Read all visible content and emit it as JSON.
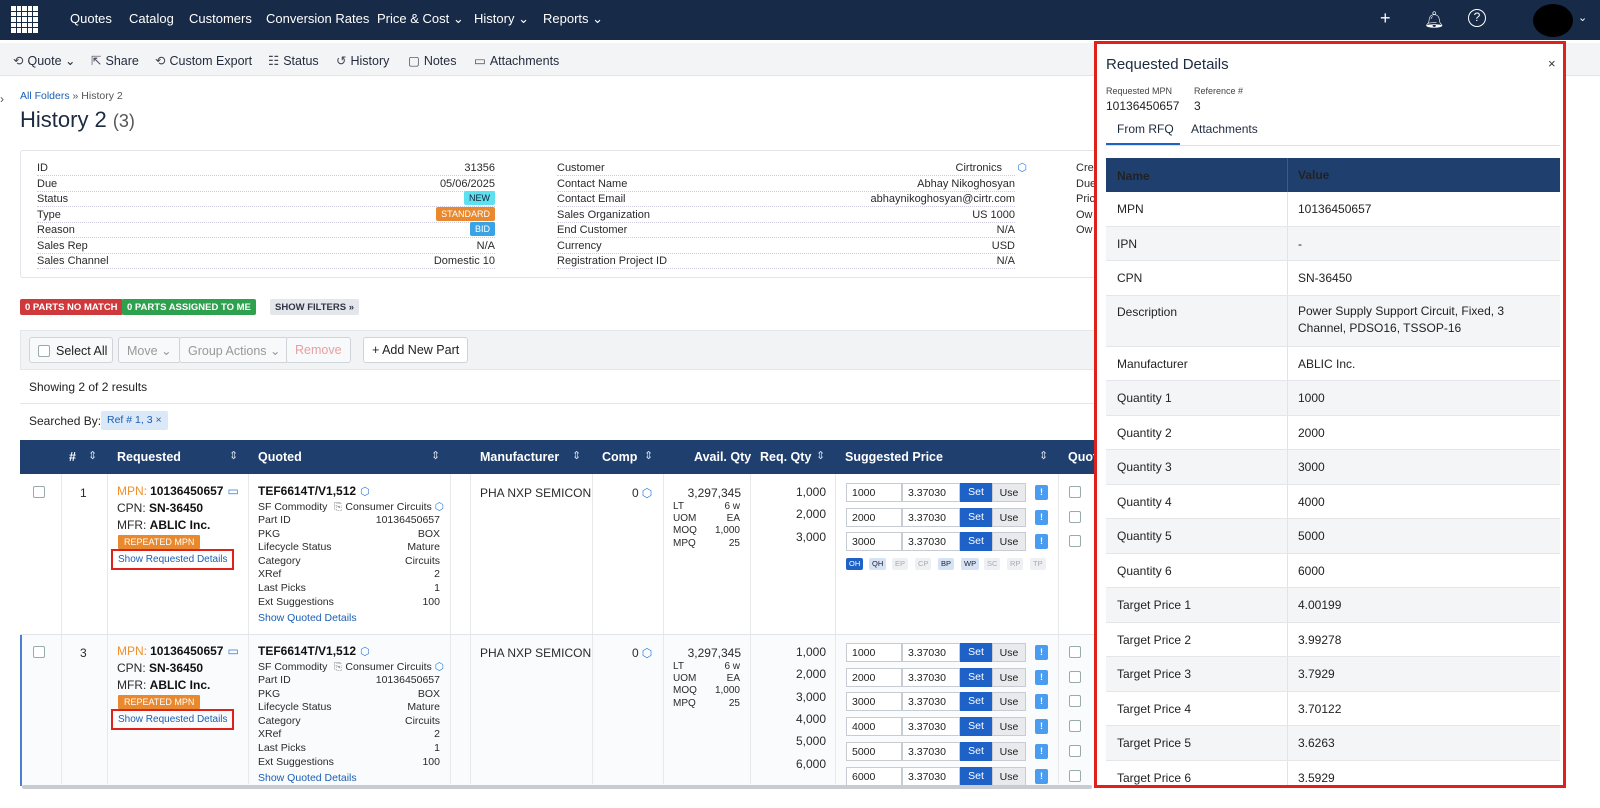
{
  "nav": {
    "items": [
      "Quotes",
      "Catalog",
      "Customers",
      "Conversion Rates",
      "Price & Cost",
      "History",
      "Reports"
    ]
  },
  "toolbar": {
    "quote": "Quote",
    "share": "Share",
    "custom_export": "Custom Export",
    "status": "Status",
    "history": "History",
    "notes": "Notes",
    "attachments": "Attachments"
  },
  "breadcrumb": {
    "root": "All Folders",
    "sep": "»",
    "current": "History 2"
  },
  "title": {
    "name": "History 2",
    "count": "(3)"
  },
  "info": {
    "left": [
      {
        "k": "ID",
        "v": "31356"
      },
      {
        "k": "Due",
        "v": "05/06/2025"
      },
      {
        "k": "Status",
        "v": "NEW"
      },
      {
        "k": "Type",
        "v": "STANDARD"
      },
      {
        "k": "Reason",
        "v": "BID"
      },
      {
        "k": "Sales Rep",
        "v": "N/A"
      },
      {
        "k": "Sales Channel",
        "v": "Domestic 10"
      }
    ],
    "mid": [
      {
        "k": "Customer",
        "v": "Cirtronics"
      },
      {
        "k": "Contact Name",
        "v": "Abhay Nikoghosyan"
      },
      {
        "k": "Contact Email",
        "v": "abhaynikoghosyan@cirtr.com"
      },
      {
        "k": "Sales Organization",
        "v": "US 1000"
      },
      {
        "k": "End Customer",
        "v": "N/A"
      },
      {
        "k": "Currency",
        "v": "USD"
      },
      {
        "k": "Registration Project ID",
        "v": "N/A"
      }
    ],
    "right": [
      "Cre",
      "Due",
      "Pric",
      "Ow",
      "Ow"
    ]
  },
  "filters": {
    "no_match": "0 PARTS NO MATCH",
    "assigned": "0 PARTS ASSIGNED TO ME",
    "show": "SHOW FILTERS »"
  },
  "actions": {
    "select_all": "Select All",
    "move": "Move",
    "group": "Group Actions",
    "remove": "Remove",
    "add": "Add New Part"
  },
  "showing": "Showing 2 of 2 results",
  "searched": {
    "label": "Searched By:",
    "chip": "Ref # 1, 3",
    "chip_x": "×"
  },
  "columns": {
    "num": "#",
    "requested": "Requested",
    "quoted": "Quoted",
    "manufacturer": "Manufacturer",
    "comp": "Comp",
    "avail": "Avail. Qty",
    "req": "Req. Qty",
    "suggested": "Suggested Price",
    "quot": "Quot"
  },
  "rows": [
    {
      "num": "1",
      "mpn_label": "MPN:",
      "mpn": "10136450657",
      "cpn_label": "CPN:",
      "cpn": "SN-36450",
      "mfr_label": "MFR:",
      "mfr": "ABLIC Inc.",
      "rep": "REPEATED MPN",
      "show_req": "Show Requested Details",
      "quoted": "TEF6614T/V1,512",
      "sf_label": "SF Commodity",
      "sf": "Consumer Circuits",
      "qd": [
        {
          "k": "Part ID",
          "v": "10136450657"
        },
        {
          "k": "PKG",
          "v": "BOX"
        },
        {
          "k": "Lifecycle Status",
          "v": "Mature"
        },
        {
          "k": "Category",
          "v": "Circuits"
        },
        {
          "k": "XRef",
          "v": "2"
        },
        {
          "k": "Last Picks",
          "v": "1"
        },
        {
          "k": "Ext Suggestions",
          "v": "100"
        }
      ],
      "show_quoted": "Show Quoted Details",
      "manufacturer": "PHA NXP SEMICON",
      "comp": "0",
      "avail": "3,297,345",
      "av": [
        {
          "k": "LT",
          "v": "6 w"
        },
        {
          "k": "UOM",
          "v": "EA"
        },
        {
          "k": "MOQ",
          "v": "1,000"
        },
        {
          "k": "MPQ",
          "v": "25"
        }
      ],
      "req": [
        "1,000",
        "2,000",
        "3,000"
      ],
      "prices": [
        {
          "q": "1000",
          "p": "3.37030"
        },
        {
          "q": "2000",
          "p": "3.37030"
        },
        {
          "q": "3000",
          "p": "3.37030"
        }
      ],
      "tags": [
        "OH",
        "QH",
        "EP",
        "CP",
        "BP",
        "WP",
        "SC",
        "RP",
        "TP"
      ]
    },
    {
      "num": "3",
      "mpn_label": "MPN:",
      "mpn": "10136450657",
      "cpn_label": "CPN:",
      "cpn": "SN-36450",
      "mfr_label": "MFR:",
      "mfr": "ABLIC Inc.",
      "rep": "REPEATED MPN",
      "show_req": "Show Requested Details",
      "quoted": "TEF6614T/V1,512",
      "sf_label": "SF Commodity",
      "sf": "Consumer Circuits",
      "qd": [
        {
          "k": "Part ID",
          "v": "10136450657"
        },
        {
          "k": "PKG",
          "v": "BOX"
        },
        {
          "k": "Lifecycle Status",
          "v": "Mature"
        },
        {
          "k": "Category",
          "v": "Circuits"
        },
        {
          "k": "XRef",
          "v": "2"
        },
        {
          "k": "Last Picks",
          "v": "1"
        },
        {
          "k": "Ext Suggestions",
          "v": "100"
        }
      ],
      "show_quoted": "Show Quoted Details",
      "manufacturer": "PHA NXP SEMICON",
      "comp": "0",
      "avail": "3,297,345",
      "av": [
        {
          "k": "LT",
          "v": "6 w"
        },
        {
          "k": "UOM",
          "v": "EA"
        },
        {
          "k": "MOQ",
          "v": "1,000"
        },
        {
          "k": "MPQ",
          "v": "25"
        }
      ],
      "req": [
        "1,000",
        "2,000",
        "3,000",
        "4,000",
        "5,000",
        "6,000"
      ],
      "prices": [
        {
          "q": "1000",
          "p": "3.37030"
        },
        {
          "q": "2000",
          "p": "3.37030"
        },
        {
          "q": "3000",
          "p": "3.37030"
        },
        {
          "q": "4000",
          "p": "3.37030"
        },
        {
          "q": "5000",
          "p": "3.37030"
        },
        {
          "q": "6000",
          "p": "3.37030"
        }
      ]
    }
  ],
  "price_buttons": {
    "set": "Set",
    "use": "Use",
    "ex": "!"
  },
  "panel": {
    "title": "Requested Details",
    "close": "×",
    "mpn_label": "Requested MPN",
    "mpn": "10136450657",
    "ref_label": "Reference #",
    "ref": "3",
    "tab1": "From RFQ",
    "tab2": "Attachments",
    "h_name": "Name",
    "h_value": "Value",
    "rows": [
      {
        "k": "MPN",
        "v": "10136450657"
      },
      {
        "k": "IPN",
        "v": "-"
      },
      {
        "k": "CPN",
        "v": "SN-36450"
      },
      {
        "k": "Description",
        "v": "Power Supply Support Circuit, Fixed, 3 Channel, PDSO16, TSSOP-16"
      },
      {
        "k": "Manufacturer",
        "v": "ABLIC Inc."
      },
      {
        "k": "Quantity 1",
        "v": "1000"
      },
      {
        "k": "Quantity 2",
        "v": "2000"
      },
      {
        "k": "Quantity 3",
        "v": "3000"
      },
      {
        "k": "Quantity 4",
        "v": "4000"
      },
      {
        "k": "Quantity 5",
        "v": "5000"
      },
      {
        "k": "Quantity 6",
        "v": "6000"
      },
      {
        "k": "Target Price 1",
        "v": "4.00199"
      },
      {
        "k": "Target Price 2",
        "v": "3.99278"
      },
      {
        "k": "Target Price 3",
        "v": "3.7929"
      },
      {
        "k": "Target Price 4",
        "v": "3.70122"
      },
      {
        "k": "Target Price 5",
        "v": "3.6263"
      },
      {
        "k": "Target Price 6",
        "v": "3.5929"
      }
    ]
  }
}
